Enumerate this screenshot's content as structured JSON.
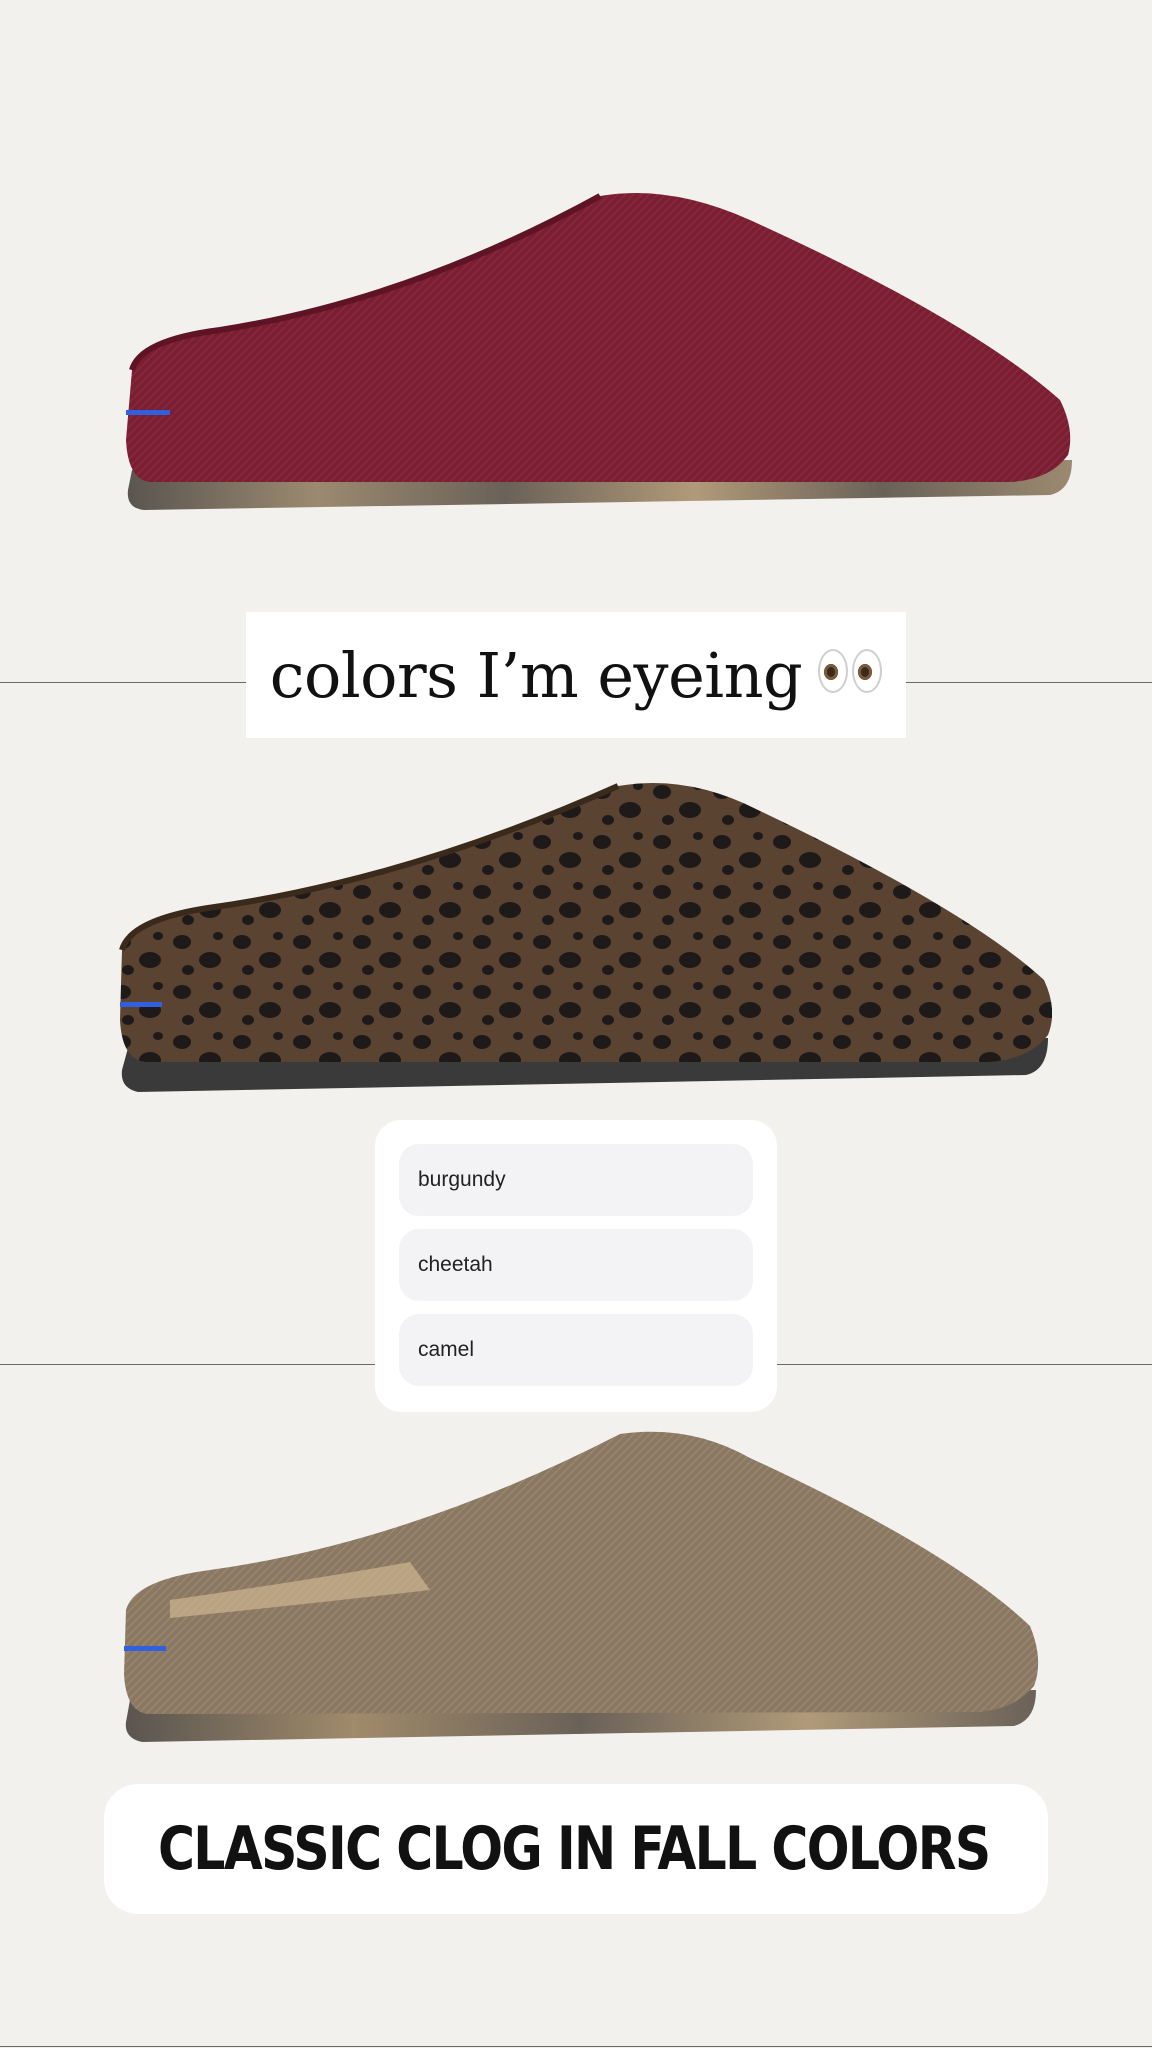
{
  "story": {
    "caption": {
      "text": "colors I’m eyeing",
      "emoji": "eyes-emoji"
    },
    "products": [
      {
        "name": "burgundy-clog",
        "color": "#7d1f33"
      },
      {
        "name": "cheetah-clog",
        "color": "#4e3a2a"
      },
      {
        "name": "camel-clog",
        "color": "#8e7c66"
      }
    ],
    "poll": {
      "options": [
        "burgundy",
        "cheetah",
        "camel"
      ]
    },
    "link": {
      "label": "CLASSIC CLOG IN FALL COLORS",
      "icon": "link-icon"
    }
  },
  "colors": {
    "background": "#f2f1ee",
    "sticker": "#ffffff",
    "poll_option": "#f3f3f5",
    "accent_blue": "#3060e0"
  }
}
